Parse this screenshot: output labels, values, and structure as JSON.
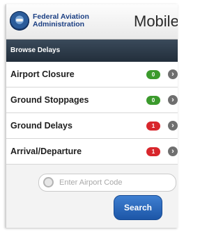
{
  "header": {
    "agency_line1": "Federal Aviation",
    "agency_line2": "Administration",
    "app_title": "Mobile"
  },
  "section": {
    "title": "Browse Delays"
  },
  "delays": [
    {
      "label": "Airport Closure",
      "count": "0",
      "status": "green"
    },
    {
      "label": "Ground Stoppages",
      "count": "0",
      "status": "green"
    },
    {
      "label": "Ground Delays",
      "count": "1",
      "status": "red"
    },
    {
      "label": "Arrival/Departure",
      "count": "1",
      "status": "red"
    }
  ],
  "search": {
    "placeholder": "Enter Airport Code",
    "button_label": "Search"
  },
  "colors": {
    "brand_blue": "#1b3f83",
    "status_green": "#3b9a2c",
    "status_red": "#d8262c",
    "button_blue": "#2d6cc0"
  },
  "icons": {
    "seal": "faa-seal-icon",
    "row_arrow": "chevron-right-icon",
    "search": "search-icon"
  }
}
